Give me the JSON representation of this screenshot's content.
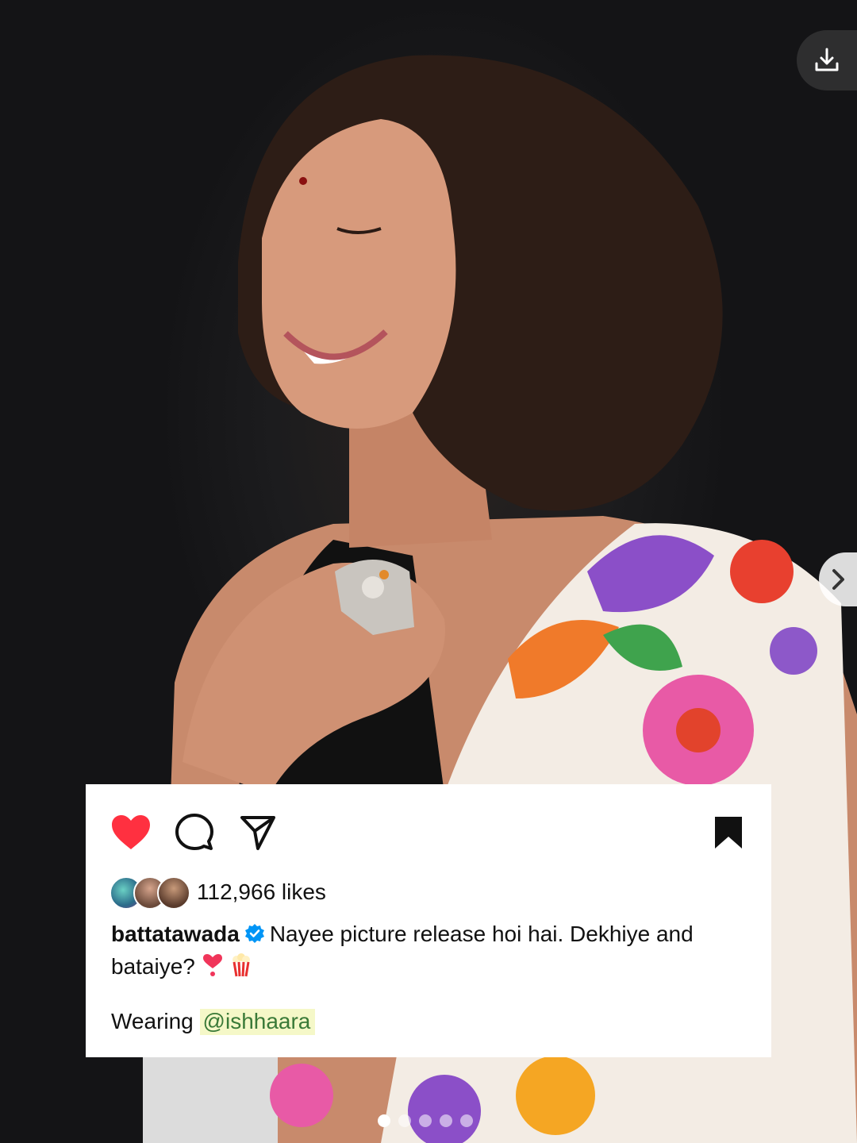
{
  "post": {
    "username": "battatawada",
    "likes": "112,966 likes",
    "caption_text": "Nayee picture release hoi hai. Dekhiye and bataiye?",
    "wearing_text": "Wearing",
    "mention": "@ishhaara",
    "liked": true,
    "saved": true,
    "carousel_total": 5,
    "carousel_index": 1
  },
  "icons": {
    "download": "download-icon",
    "next": "chevron-right-icon",
    "like": "heart-icon",
    "comment": "comment-icon",
    "share": "send-icon",
    "save": "bookmark-icon",
    "verified": "verified-badge-icon"
  },
  "colors": {
    "like_red": "#ff3040",
    "verified_blue": "#0095f6",
    "mention_highlight": "#f5f8c8"
  }
}
